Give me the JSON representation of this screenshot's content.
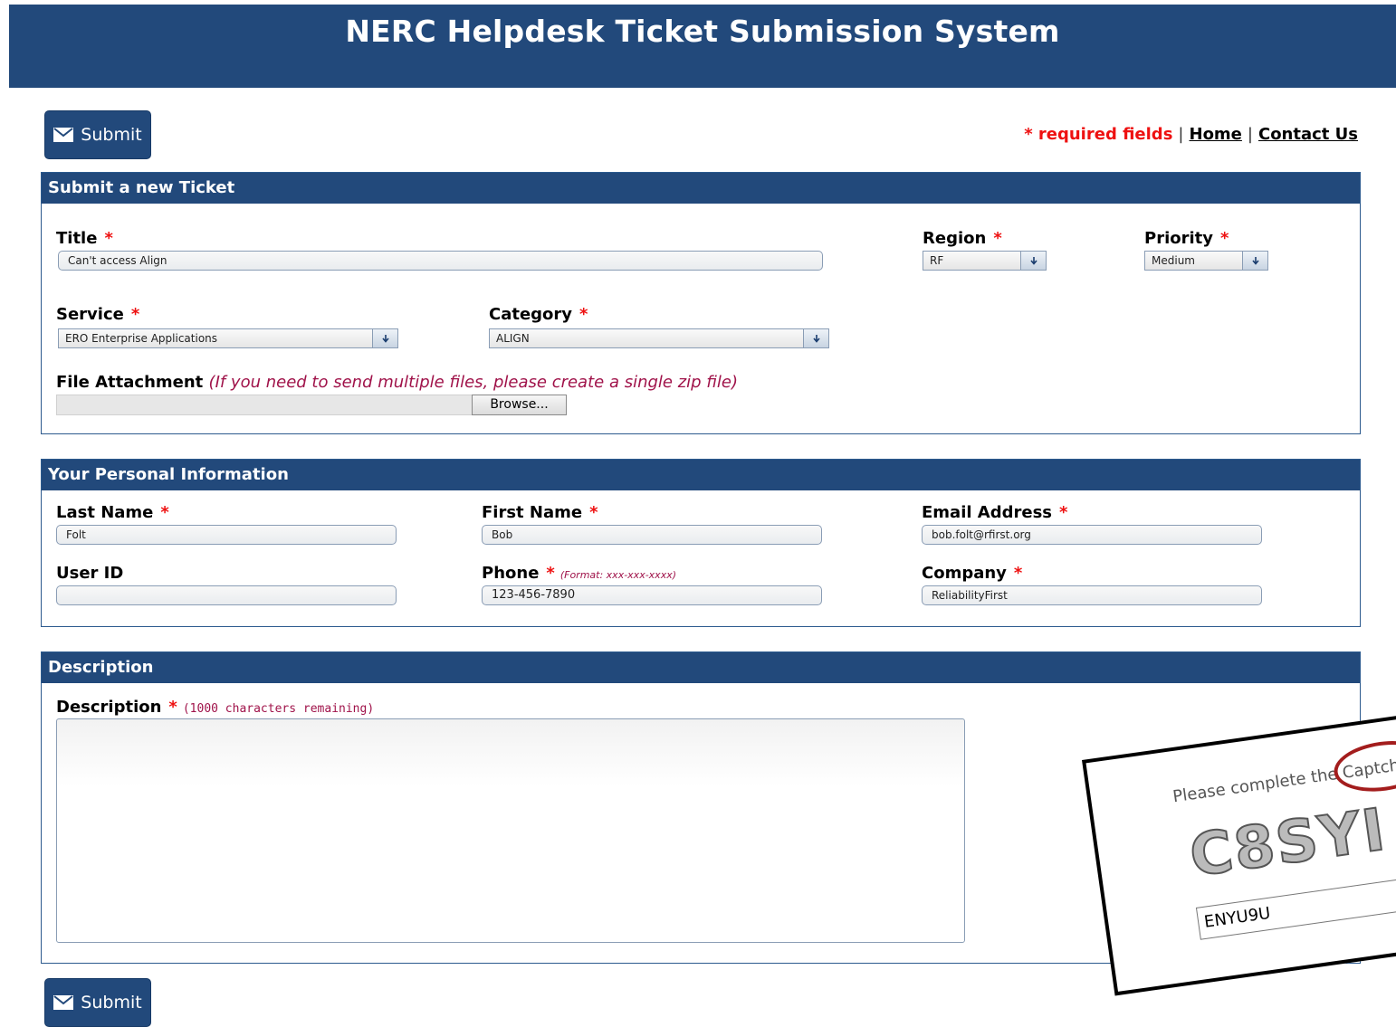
{
  "header": {
    "title": "NERC Helpdesk Ticket Submission System"
  },
  "submit_label": "Submit",
  "toplinks": {
    "required": "* required fields",
    "sep": "|",
    "home": "Home",
    "contact": "Contact Us"
  },
  "ticket": {
    "heading": "Submit a new Ticket",
    "title_label": "Title",
    "title_value": "Can't access Align",
    "region_label": "Region",
    "region_value": "RF",
    "priority_label": "Priority",
    "priority_value": "Medium",
    "service_label": "Service",
    "service_value": "ERO Enterprise Applications",
    "category_label": "Category",
    "category_value": "ALIGN",
    "file_label": "File Attachment",
    "file_hint": "(If you need to send multiple files, please create a single zip file)",
    "browse_label": "Browse..."
  },
  "personal": {
    "heading": "Your Personal Information",
    "last_label": "Last Name",
    "last_value": "Folt",
    "first_label": "First Name",
    "first_value": "Bob",
    "email_label": "Email Address",
    "email_value": "bob.folt@rfirst.org",
    "userid_label": "User ID",
    "userid_value": "",
    "phone_label": "Phone",
    "phone_hint": "(Format: xxx-xxx-xxxx)",
    "phone_value": "123-456-7890",
    "company_label": "Company",
    "company_value": "ReliabilityFirst"
  },
  "description": {
    "heading": "Description",
    "label": "Description",
    "remaining": "(1000 characters remaining)",
    "value": ""
  },
  "captcha": {
    "prompt": "Please complete the Captcha",
    "code": "C8SYI",
    "answer": "ENYU9U"
  },
  "star": "*",
  "colors": {
    "primary": "#22497b",
    "required": "#ee1111",
    "hint": "#a0134a",
    "ring": "#a31d1d"
  }
}
